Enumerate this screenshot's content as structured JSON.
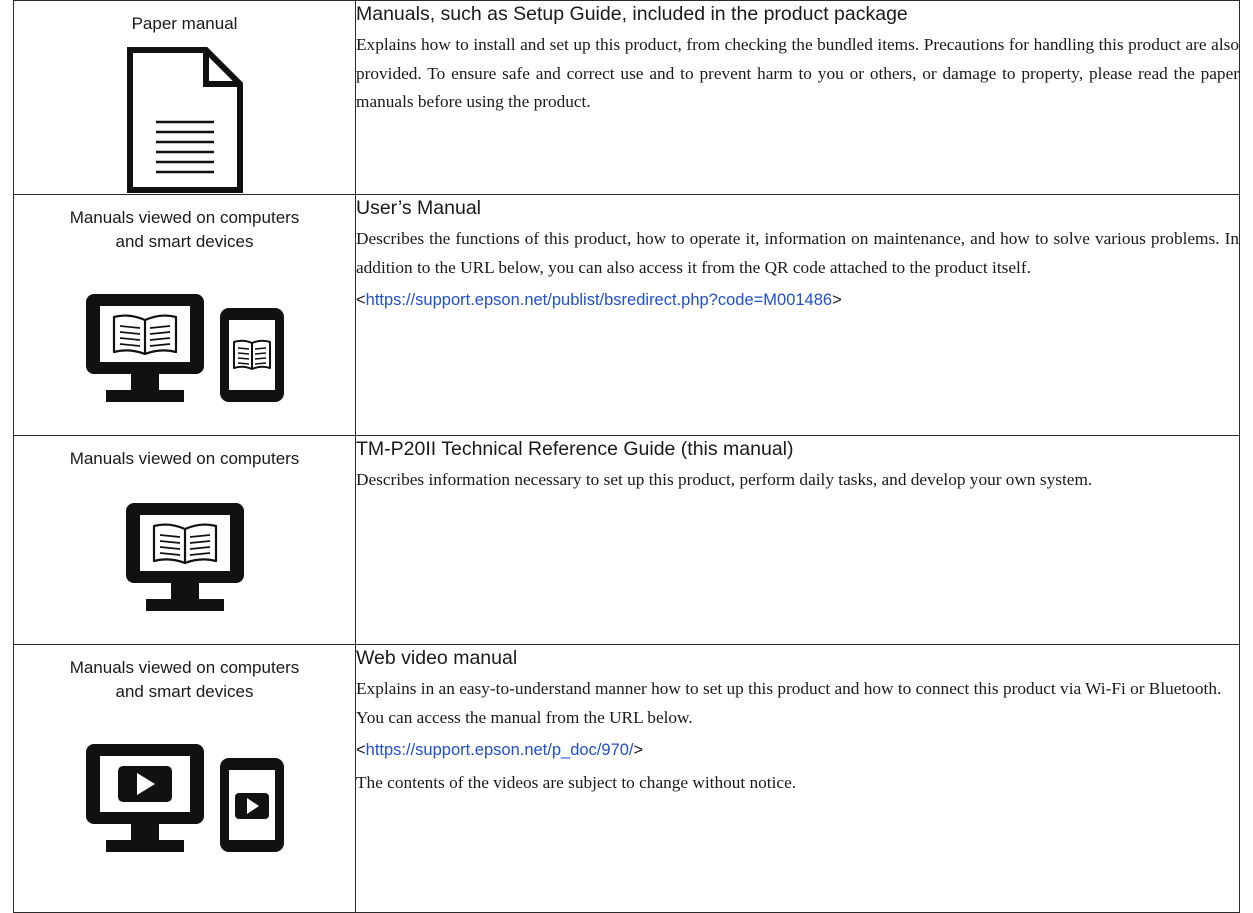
{
  "rows": [
    {
      "category": "Paper manual",
      "icon": "document-icon",
      "title": "Manuals, such as Setup Guide, included in the product package",
      "description": "Explains how to install and set up this product, from checking the bundled items. Precautions for handling this product are also provided. To ensure safe and correct use and to prevent harm to you or others, or damage to property, please read the paper manuals before using the product."
    },
    {
      "category": "Manuals viewed on computers\nand smart devices",
      "icon": "computer-and-tablet-book-icon",
      "title": "User’s Manual",
      "description": "Describes the functions of this product, how to operate it, information on maintenance, and how to solve various problems. In addition to the URL below, you can also access it from the QR code attached to the product itself.",
      "url_open": "<",
      "url": "https://support.epson.net/publist/bsredirect.php?code=M001486",
      "url_close": ">"
    },
    {
      "category": "Manuals viewed on computers",
      "icon": "computer-book-icon",
      "title": "TM-P20II Technical Reference Guide (this manual)",
      "description": "Describes information necessary to set up this product, perform daily tasks, and develop your own system."
    },
    {
      "category": "Manuals viewed on computers\nand smart devices",
      "icon": "computer-and-tablet-video-icon",
      "title": "Web video manual",
      "description": "Explains in an easy-to-understand manner how to set up this product and how to connect this product via Wi-Fi or Bluetooth. You can access the manual from the URL below.",
      "url_open": "<",
      "url": "https://support.epson.net/p_doc/970/",
      "url_close": ">",
      "note": "The contents of the videos are subject to change without notice."
    }
  ],
  "colors": {
    "link": "#1f4fd6",
    "border": "#2a2a2a",
    "text": "#1a1a1a"
  }
}
